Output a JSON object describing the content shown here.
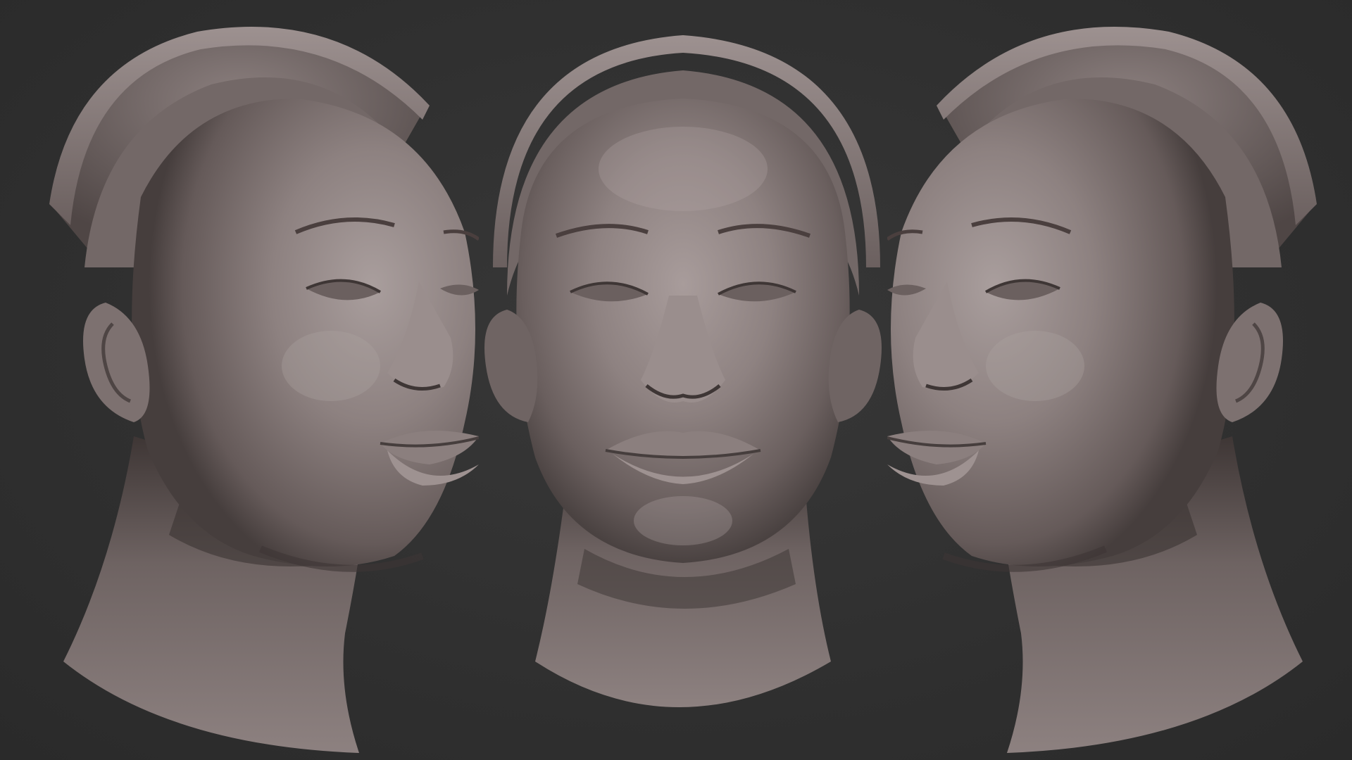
{
  "scene": {
    "background_color": "#2f2f2f",
    "material_color": "#8a7e7d",
    "views": [
      {
        "name": "three-quarter-left",
        "icon": "head-sculpt-three-quarter-left"
      },
      {
        "name": "front",
        "icon": "head-sculpt-front"
      },
      {
        "name": "three-quarter-right",
        "icon": "head-sculpt-three-quarter-right"
      }
    ]
  }
}
